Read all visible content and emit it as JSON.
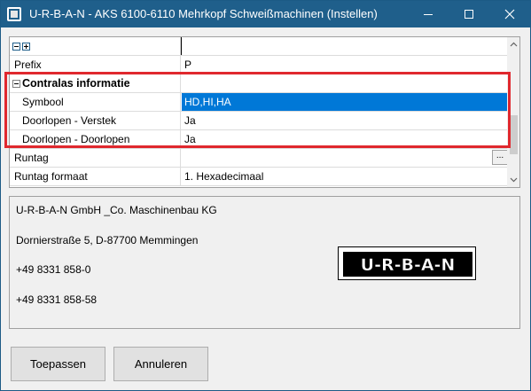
{
  "window": {
    "title": "U-R-B-A-N - AKS 6100-6110 Mehrkopf Schweißmachinen (Instellen)"
  },
  "titlebar_icons": {
    "app": "app-icon",
    "minimize": "minimize-icon",
    "maximize": "maximize-icon",
    "close": "close-icon"
  },
  "property_grid": {
    "rows": [
      {
        "name": "",
        "value": "",
        "kind": "toolbar"
      },
      {
        "name": "Prefix",
        "value": "P"
      },
      {
        "name": "Contralas informatie",
        "value": "",
        "kind": "category"
      },
      {
        "name": "Symbool",
        "value": "HD,HI,HA",
        "selected": true
      },
      {
        "name": "Doorlopen - Verstek",
        "value": "Ja"
      },
      {
        "name": "Doorlopen - Doorlopen",
        "value": "Ja"
      },
      {
        "name": "Runtag",
        "value": "",
        "ellipsis": "..."
      },
      {
        "name": "Runtag formaat",
        "value": "1. Hexadecimaal"
      }
    ],
    "highlight_color": "#e0282e",
    "selection_color": "#0078d7"
  },
  "info": {
    "company": "U-R-B-A-N GmbH _Co. Maschinenbau KG",
    "address": "Dornierstraße 5, D-87700 Memmingen",
    "phone": "+49 8331 858-0",
    "fax": "+49 8331 858-58",
    "logo_text": "U-R-B-A-N"
  },
  "buttons": {
    "apply": "Toepassen",
    "cancel": "Annuleren"
  }
}
